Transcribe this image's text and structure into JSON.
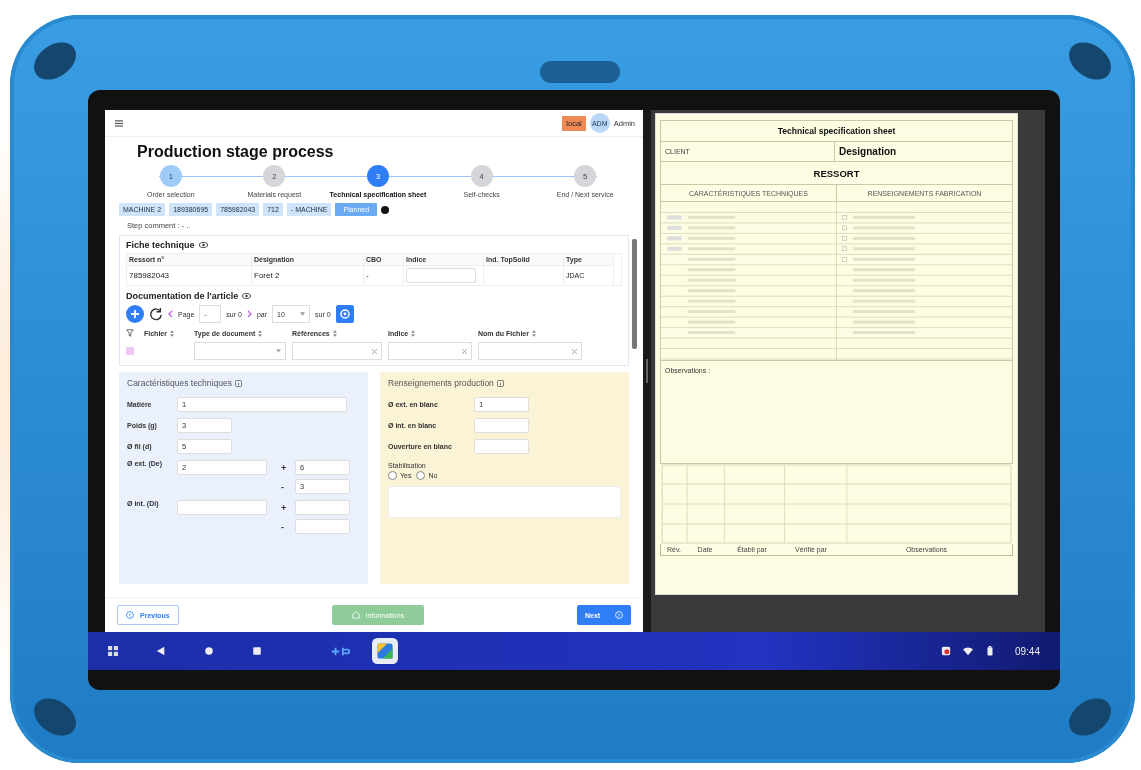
{
  "app": {
    "env_badge": "local",
    "user": {
      "initials": "ADM",
      "name": "Admin"
    }
  },
  "page_title": "Production stage process",
  "steps": [
    {
      "number": "1",
      "label": "Order selection",
      "selected": false,
      "completed": true
    },
    {
      "number": "2",
      "label": "Materials request",
      "selected": false,
      "completed": false
    },
    {
      "number": "3",
      "label": "Technical specification sheet",
      "selected": true,
      "completed": false
    },
    {
      "number": "4",
      "label": "Self-checks",
      "selected": false,
      "completed": false
    },
    {
      "number": "5",
      "label": "End / Next service",
      "selected": false,
      "completed": false
    }
  ],
  "chips": [
    {
      "label": "MACHINE 2",
      "kind": "tag"
    },
    {
      "label": "189380695",
      "kind": "tag"
    },
    {
      "label": "785982043",
      "kind": "tag"
    },
    {
      "label": "712",
      "kind": "tag"
    },
    {
      "label": "- MACHINE",
      "kind": "tag"
    },
    {
      "label": "Planned",
      "kind": "status"
    }
  ],
  "status_dot": {
    "color": "#111111"
  },
  "step_comment": "Step comment : - ..",
  "fiche": {
    "title": "Fiche technique",
    "columns": [
      "Ressort n°",
      "Désignation",
      "CBO",
      "Indice",
      "Ind. TopSolid",
      "Type"
    ],
    "row": [
      {
        "kind": "text",
        "value": "785982043"
      },
      {
        "kind": "text",
        "value": "Foret 2"
      },
      {
        "kind": "text",
        "value": "-"
      },
      {
        "kind": "field"
      },
      {
        "kind": "text"
      },
      {
        "kind": "text",
        "value": "JDAC"
      }
    ]
  },
  "documentation": {
    "title": "Documentation de l'article",
    "page_label": "Page",
    "page_value": "-",
    "page_total": "sur 0",
    "per_label": "par",
    "per_value": "10",
    "count": "sur 0",
    "select_all": {
      "checked": false
    },
    "columns": [
      {
        "label": "Fichier",
        "kind": "none"
      },
      {
        "label": "Type de document",
        "kind": "select"
      },
      {
        "label": "Références",
        "kind": "text"
      },
      {
        "label": "Indice",
        "kind": "text"
      },
      {
        "label": "Nom du Fichier",
        "kind": "text"
      }
    ]
  },
  "caracteristiques": {
    "title": "Caractéristiques techniques",
    "fields": [
      {
        "label": "Matière",
        "value": "1",
        "kind": "wide"
      },
      {
        "label": "Poids (g)",
        "value": "3",
        "kind": "short"
      },
      {
        "label": "Ø fil (d)",
        "value": "5",
        "kind": "short"
      },
      {
        "label": "Ø ext. (De)",
        "value": "2",
        "kind": "tolerance",
        "plus_sign": "+",
        "plus": "6",
        "minus_sign": "-",
        "minus": "3"
      },
      {
        "label": "Ø int. (Di)",
        "kind": "tolerance",
        "plus_sign": "+",
        "minus_sign": "-"
      }
    ]
  },
  "production": {
    "title": "Renseignements production",
    "fields": [
      {
        "label": "Ø ext. en blanc",
        "value": "1"
      },
      {
        "label": "Ø int. en blanc"
      },
      {
        "label": "Ouverture en blanc"
      }
    ],
    "stabilisation": {
      "label": "Stabilisation",
      "options": [
        {
          "label": "Yes",
          "selected": false
        },
        {
          "label": "No",
          "selected": false
        }
      ]
    }
  },
  "footer": {
    "previous": "Previous",
    "informations": {
      "label": "Informations",
      "disabled": true
    },
    "next": "Next"
  },
  "document": {
    "title": "Technical specification sheet",
    "client_label": "CLIENT",
    "designation_label": "Designation",
    "product": "RESSORT",
    "left_heading": "CARACTÉRISTIQUES TECHNIQUES",
    "right_heading": "RENSEIGNEMENTS FABRICATION",
    "observations_label": "Observations :",
    "table_headers": [
      "Rév.",
      "Date",
      "Établi par",
      "Vérifié par",
      "Observations"
    ]
  },
  "taskbar": {
    "time": "09:44"
  }
}
